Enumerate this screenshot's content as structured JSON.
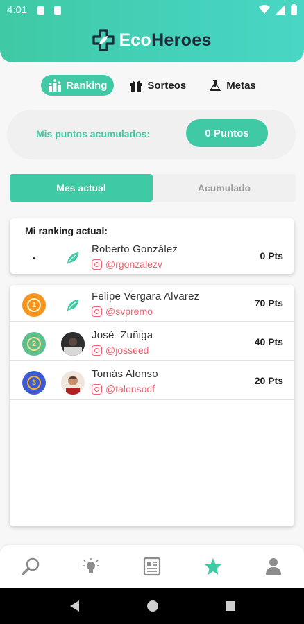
{
  "status_bar": {
    "time": "4:01"
  },
  "app": {
    "logo_part1": "Eco",
    "logo_part2": "Heroes"
  },
  "tabs": [
    {
      "label": "Ranking",
      "icon": "podium-icon",
      "active": true
    },
    {
      "label": "Sorteos",
      "icon": "gift-icon",
      "active": false
    },
    {
      "label": "Metas",
      "icon": "flask-icon",
      "active": false
    }
  ],
  "points": {
    "label": "Mis puntos acumulados:",
    "value": "0 Puntos"
  },
  "segments": [
    {
      "label": "Mes actual",
      "active": true
    },
    {
      "label": "Acumulado",
      "active": false
    }
  ],
  "my_ranking": {
    "title": "Mi ranking actual:",
    "rank": "-",
    "name": "Roberto González",
    "handle": "@rgonzalezv",
    "points": "0 Pts"
  },
  "ranking": [
    {
      "position": "1",
      "medal_color": "#f7941d",
      "name": "Felipe Vergara Alvarez",
      "handle": "@svpremo",
      "points": "70 Pts",
      "avatar": "leaf"
    },
    {
      "position": "2",
      "medal_color": "#5dbf8d",
      "name": "José  Zuñiga",
      "handle": "@josseed",
      "points": "40 Pts",
      "avatar": "photo"
    },
    {
      "position": "3",
      "medal_color": "#3d5bd1",
      "name": "Tomás Alonso",
      "handle": "@talonsodf",
      "points": "20 Pts",
      "avatar": "photo"
    }
  ],
  "bottom_nav": [
    {
      "icon": "search-icon",
      "active": false
    },
    {
      "icon": "lightbulb-icon",
      "active": false
    },
    {
      "icon": "news-icon",
      "active": false
    },
    {
      "icon": "star-icon",
      "active": true
    },
    {
      "icon": "user-icon",
      "active": false
    }
  ],
  "colors": {
    "primary": "#3fc9a4",
    "instagram": "#f06070",
    "dark": "#1b2b3a"
  }
}
